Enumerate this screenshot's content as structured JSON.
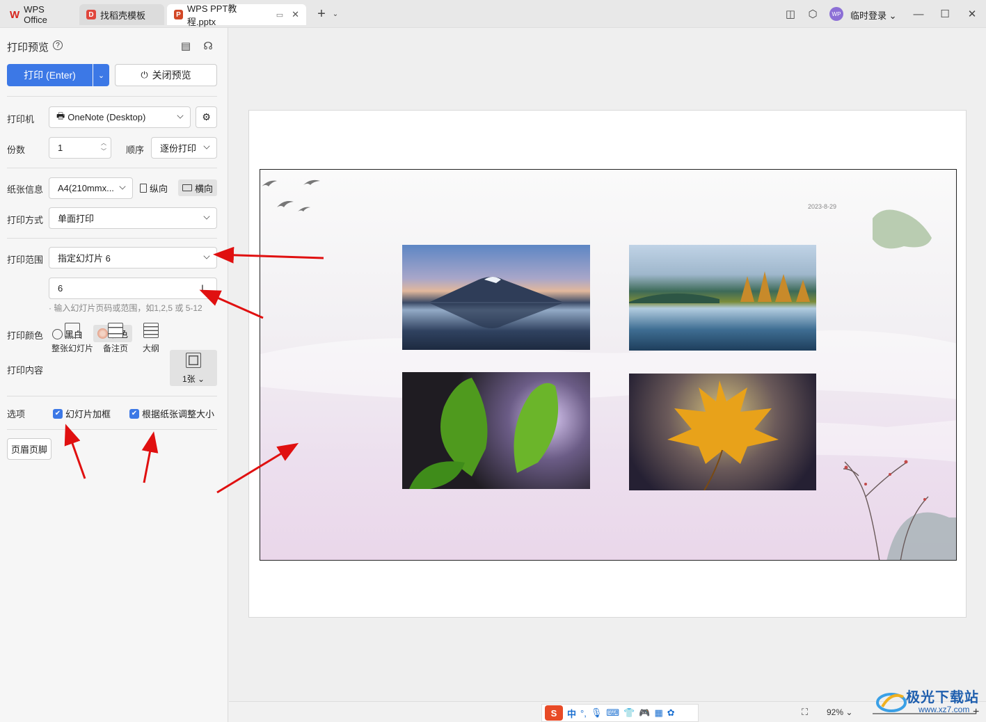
{
  "tabs": [
    {
      "label": "WPS Office",
      "icon": "wps-logo-icon"
    },
    {
      "label": "找稻壳模板",
      "icon": "docer-icon"
    },
    {
      "label": "WPS PPT教程.pptx",
      "icon": "ppt-icon"
    }
  ],
  "titlebar": {
    "user_label": "临时登录",
    "avatar_text": "WP"
  },
  "panel": {
    "title": "打印预览",
    "print_button": "打印 (Enter)",
    "close_preview_button": "关闭预览",
    "printer_label": "打印机",
    "printer_value": "OneNote (Desktop)",
    "copies_label": "份数",
    "copies_value": "1",
    "order_label": "顺序",
    "order_value": "逐份打印",
    "paper_label": "纸张信息",
    "paper_value": "A4(210mmx...",
    "portrait_label": "纵向",
    "landscape_label": "横向",
    "mode_label": "打印方式",
    "mode_value": "单面打印",
    "range_label": "打印范围",
    "range_value": "指定幻灯片 6",
    "range_input_value": "6",
    "range_hint": "· 输入幻灯片页码或范围，如1,2,5 或 5-12",
    "color_label": "打印颜色",
    "color_bw": "黑白",
    "color_color": "彩色",
    "content_label": "打印内容",
    "content_items": [
      "整张幻灯片",
      "备注页",
      "大纲",
      "1张"
    ],
    "options_label": "选项",
    "option_frame": "幻灯片加框",
    "option_fit": "根据纸张调整大小",
    "header_footer_button": "页眉页脚"
  },
  "slide": {
    "date": "2023-8-29"
  },
  "status": {
    "zoom": "92%"
  },
  "ime": {
    "lang": "中"
  },
  "watermark": {
    "name": "极光下载站",
    "url": "www.xz7.com"
  },
  "colors": {
    "accent": "#3c78e6",
    "arrow": "#e01010"
  }
}
